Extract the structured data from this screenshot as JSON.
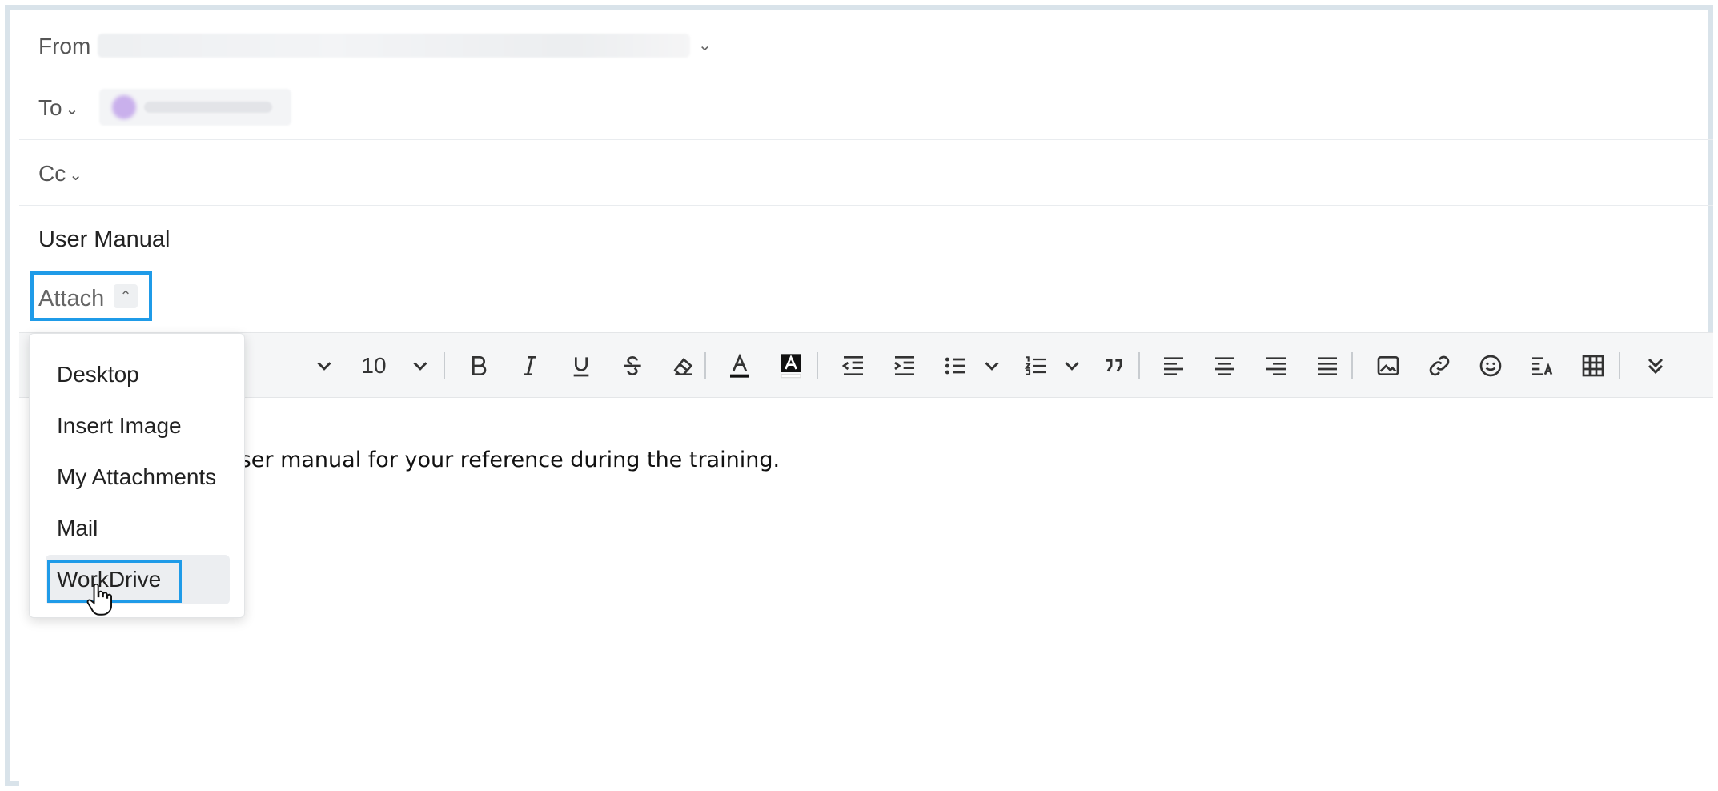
{
  "compose": {
    "from_label": "From",
    "to_label": "To",
    "cc_label": "Cc",
    "subject": "User Manual",
    "attach_label": "Attach"
  },
  "toolbar": {
    "font_size": "10"
  },
  "editor": {
    "body_visible_text": "d the user manual for your reference during the training."
  },
  "attach_menu": {
    "items": [
      "Desktop",
      "Insert Image",
      "My Attachments",
      "Mail",
      "WorkDrive"
    ],
    "hovered": "WorkDrive"
  },
  "colors": {
    "highlight_border": "#1f9be8",
    "frame_border": "#d9e3ea",
    "toolbar_bg": "#f5f6f7"
  }
}
